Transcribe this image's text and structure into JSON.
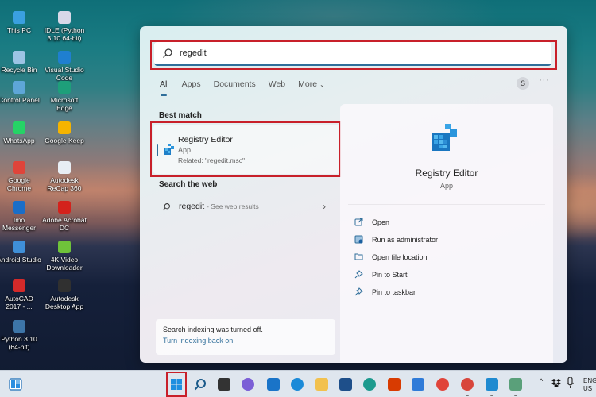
{
  "desktop": {
    "icons": [
      {
        "label": "This PC",
        "icon": "computer-icon",
        "color": "#3aa0e0"
      },
      {
        "label": "IDLE (Python 3.10 64-bit)",
        "icon": "python-idle-icon",
        "color": "#d8d8e8"
      },
      {
        "label": "Recycle Bin",
        "icon": "recycle-bin-icon",
        "color": "#9cc4e4"
      },
      {
        "label": "Visual Studio Code",
        "icon": "vscode-icon",
        "color": "#1f7fd0"
      },
      {
        "label": "Control Panel",
        "icon": "control-panel-icon",
        "color": "#5ea6d8"
      },
      {
        "label": "Microsoft Edge",
        "icon": "edge-icon",
        "color": "#1e9f7a"
      },
      {
        "label": "WhatsApp",
        "icon": "whatsapp-icon",
        "color": "#25d366"
      },
      {
        "label": "Google Keep",
        "icon": "google-keep-icon",
        "color": "#f5b400"
      },
      {
        "label": "Google Chrome",
        "icon": "chrome-icon",
        "color": "#e0443a"
      },
      {
        "label": "Autodesk ReCap 360",
        "icon": "recap-icon",
        "color": "#e8eef4"
      },
      {
        "label": "Imo Messenger",
        "icon": "imo-icon",
        "color": "#1a6ec8"
      },
      {
        "label": "Adobe Acrobat DC",
        "icon": "acrobat-icon",
        "color": "#d4221c"
      },
      {
        "label": "Android Studio",
        "icon": "android-studio-icon",
        "color": "#3f8fd8"
      },
      {
        "label": "4K Video Downloader",
        "icon": "4k-downloader-icon",
        "color": "#6fc23a"
      },
      {
        "label": "AutoCAD 2017 - ...",
        "icon": "autocad-icon",
        "color": "#d42a2a"
      },
      {
        "label": "Autodesk Desktop App",
        "icon": "autodesk-app-icon",
        "color": "#303030"
      },
      {
        "label": "Python 3.10 (64-bit)",
        "icon": "python-icon",
        "color": "#3d75a8"
      }
    ]
  },
  "search": {
    "query": "regedit",
    "tabs": [
      "All",
      "Apps",
      "Documents",
      "Web",
      "More"
    ],
    "active_tab": "All",
    "more_chevron": "⌄",
    "avatar_initial": "S",
    "more_options": "···",
    "best_match_title": "Best match",
    "best_match": {
      "name": "Registry Editor",
      "type": "App",
      "related": "Related: \"regedit.msc\""
    },
    "web_title": "Search the web",
    "web_result": {
      "query": "regedit",
      "suffix": "- See web results",
      "chevron": "›"
    },
    "detail": {
      "name": "Registry Editor",
      "type": "App",
      "actions": [
        {
          "label": "Open",
          "icon": "open-icon"
        },
        {
          "label": "Run as administrator",
          "icon": "run-as-admin-icon"
        },
        {
          "label": "Open file location",
          "icon": "folder-icon"
        },
        {
          "label": "Pin to Start",
          "icon": "pin-icon"
        },
        {
          "label": "Pin to taskbar",
          "icon": "pin-icon"
        }
      ]
    },
    "indexing": {
      "message": "Search indexing was turned off.",
      "link": "Turn indexing back on."
    }
  },
  "taskbar": {
    "widgets_icon": "widgets-icon",
    "apps": [
      {
        "name": "start",
        "icon": "windows-start-icon",
        "color": "#1e8fe0"
      },
      {
        "name": "search",
        "icon": "search-icon",
        "color": "#1a5a8a"
      },
      {
        "name": "task-view",
        "icon": "task-view-icon",
        "color": "#333333"
      },
      {
        "name": "teams-chat",
        "icon": "teams-chat-icon",
        "color": "#7b5fd6"
      },
      {
        "name": "outlook",
        "icon": "mail-app-icon",
        "color": "#1a74c8"
      },
      {
        "name": "help",
        "icon": "help-icon",
        "color": "#1a8ad8"
      },
      {
        "name": "file-explorer",
        "icon": "file-explorer-icon",
        "color": "#f2c14e"
      },
      {
        "name": "microsoft-store",
        "icon": "store-icon",
        "color": "#1e4f8a"
      },
      {
        "name": "edge",
        "icon": "edge-icon",
        "color": "#1c9a8e"
      },
      {
        "name": "office",
        "icon": "office-icon",
        "color": "#d83b01"
      },
      {
        "name": "todo",
        "icon": "todo-icon",
        "color": "#2f7bd8"
      },
      {
        "name": "chrome",
        "icon": "chrome-icon",
        "color": "#e0443a"
      },
      {
        "name": "chrome-profile",
        "icon": "chrome-profile-icon",
        "color": "#d8463c"
      },
      {
        "name": "registry-editor",
        "icon": "registry-editor-icon",
        "color": "#1f8ad0"
      },
      {
        "name": "network-app",
        "icon": "globe-app-icon",
        "color": "#5aa07a"
      }
    ],
    "tray": {
      "chevron": "^",
      "lang_line1": "ENG",
      "lang_line2": "US"
    }
  }
}
